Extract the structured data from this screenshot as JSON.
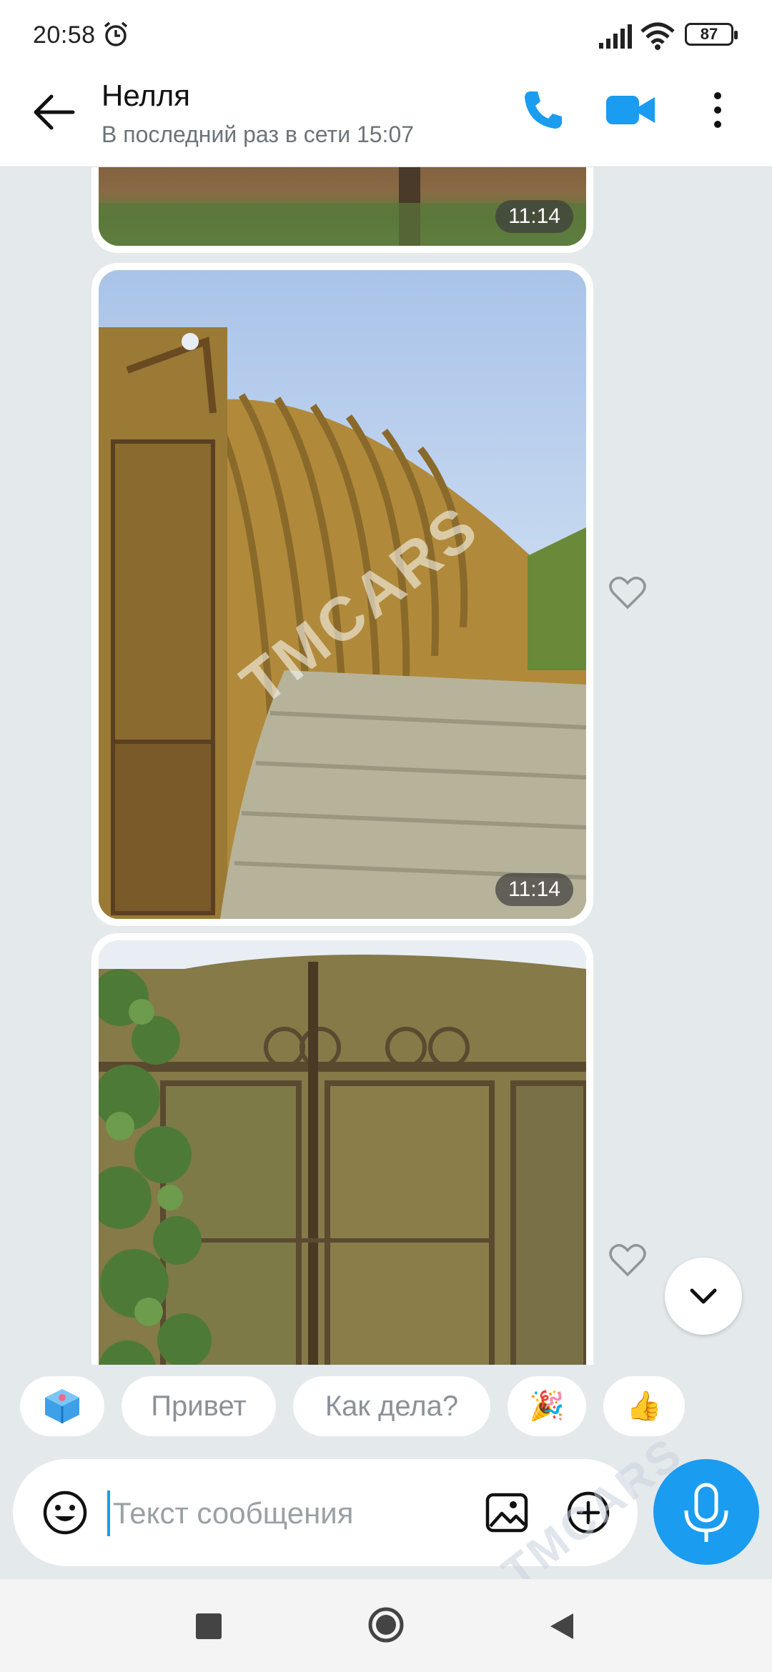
{
  "status_bar": {
    "time": "20:58",
    "battery": "87",
    "icons": [
      "alarm-icon",
      "signal-icon",
      "wifi-icon",
      "battery-icon"
    ]
  },
  "header": {
    "contact_name": "Нелля",
    "last_seen": "В последний раз в сети 15:07",
    "icons": [
      "back-arrow-icon",
      "phone-icon",
      "video-camera-icon",
      "more-vertical-icon"
    ],
    "accent_color": "#1a9cf0"
  },
  "messages": [
    {
      "type": "photo",
      "time": "11:14",
      "description_icon": "photo"
    },
    {
      "type": "photo",
      "time": "11:14",
      "watermark": "TMCARS"
    },
    {
      "type": "photo",
      "time": ""
    }
  ],
  "quick_replies": [
    {
      "label": "",
      "icon": "sticker-cube-icon"
    },
    {
      "label": "Привет"
    },
    {
      "label": "Как дела?"
    },
    {
      "label": "🎉"
    },
    {
      "label": "👍"
    }
  ],
  "composer": {
    "placeholder": "Текст сообщения",
    "value": "",
    "watermark": "TMCARS",
    "icons": [
      "emoji-icon",
      "gallery-icon",
      "plus-circle-icon",
      "microphone-icon"
    ]
  },
  "nav_bar": {
    "icons": [
      "recents-square-icon",
      "home-circle-icon",
      "back-triangle-icon"
    ]
  }
}
